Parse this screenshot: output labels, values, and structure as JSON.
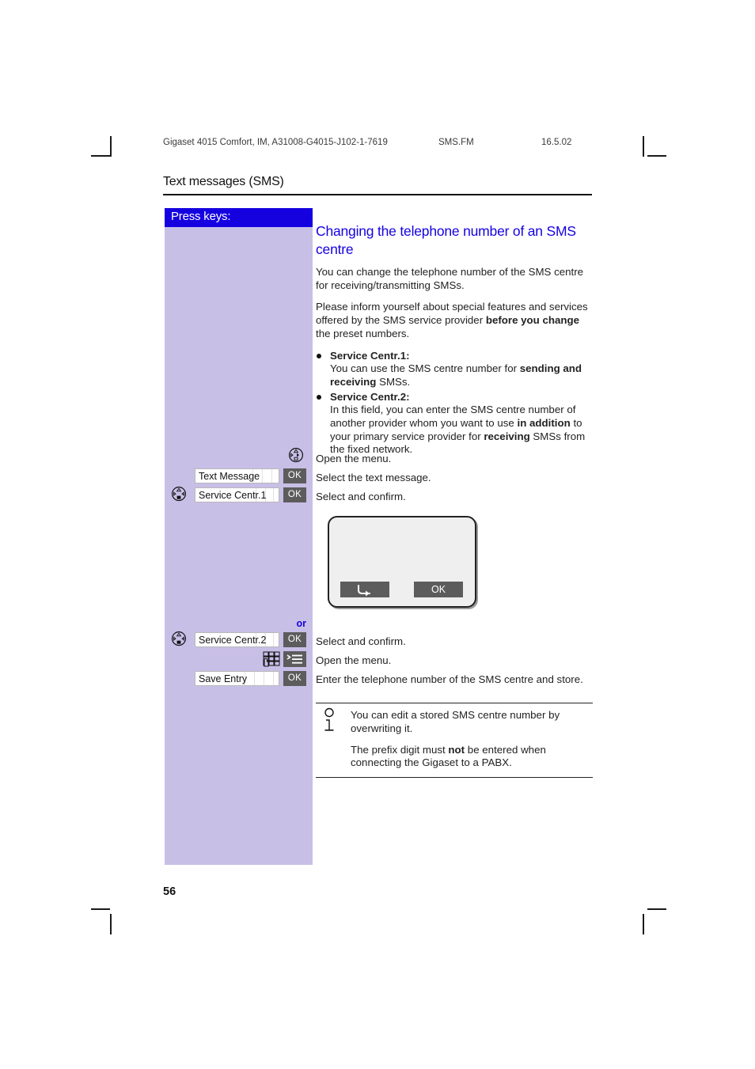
{
  "running_header": {
    "document": "Gigaset 4015 Comfort, IM, A31008-G4015-J102-1-7619",
    "file": "SMS.FM",
    "date": "16.5.02"
  },
  "chapter_title": "Text messages (SMS)",
  "keys_panel": {
    "header_label": "Press keys:",
    "or_label": "or",
    "rows": [
      {
        "icon": "navigation-key-icon",
        "field": null,
        "ok": null
      },
      {
        "icon": null,
        "field": "Text Message",
        "ok": "OK"
      },
      {
        "icon": "navigation-key-icon",
        "field": "Service Centr.1",
        "ok": "OK"
      },
      {
        "icon": "navigation-key-icon",
        "field": "Service Centr.2",
        "ok": "OK"
      },
      {
        "icon": "keypad-icon",
        "field": null,
        "ok": "menu-icon"
      },
      {
        "icon": null,
        "field": "Save Entry",
        "ok": "OK"
      }
    ],
    "field_text_1": "Text Message",
    "field_text_2": "Service Centr.1",
    "field_text_3": "Service Centr.2",
    "field_text_4": "Save Entry",
    "ok_label": "OK"
  },
  "section": {
    "heading": "Changing the telephone number of an SMS centre",
    "paragraph_1": "You can change the telephone number of the SMS centre for receiving/transmitting SMSs.",
    "paragraph_2_part_1": "Please inform yourself about special features and services offered by the SMS service provider ",
    "paragraph_2_bold": "before  you change",
    "paragraph_2_part_2": " the preset numbers.",
    "bullets": [
      {
        "title": "Service Centr.1:",
        "text_part_1": "You can use the SMS centre number for ",
        "text_bold": "sending and receiving",
        "text_part_2": " SMSs."
      },
      {
        "title": "Service Centr.2:",
        "text_part_1": "In this field, you can enter the SMS centre number of another provider whom you want to use ",
        "text_bold": "in addition",
        "text_part_2": " to your primary service provider for ",
        "text_bold_2": "receiving",
        "text_part_3": " SMSs from the fixed network."
      }
    ]
  },
  "steps": {
    "step_1": "Open the menu.",
    "step_2": "Select the text message.",
    "step_3": "Select and confirm.",
    "step_4": "Select and confirm.",
    "step_5": "Open the menu.",
    "step_6": "Enter the telephone number of the SMS centre and store."
  },
  "handset_display": {
    "back_softkey": "",
    "ok_softkey": "OK"
  },
  "note": {
    "paragraph_1": "You can edit a stored SMS centre number by overwriting it.",
    "paragraph_2_part_1": "The prefix digit must ",
    "paragraph_2_bold": "not",
    "paragraph_2_part_2": " be entered when connecting the Gigaset to a PABX."
  },
  "page_number": "56",
  "colors": {
    "panel_bg": "#c8bfe7",
    "panel_header_bg": "#1500e0",
    "accent_blue": "#1500e0",
    "key_gray": "#5c5c5c"
  }
}
